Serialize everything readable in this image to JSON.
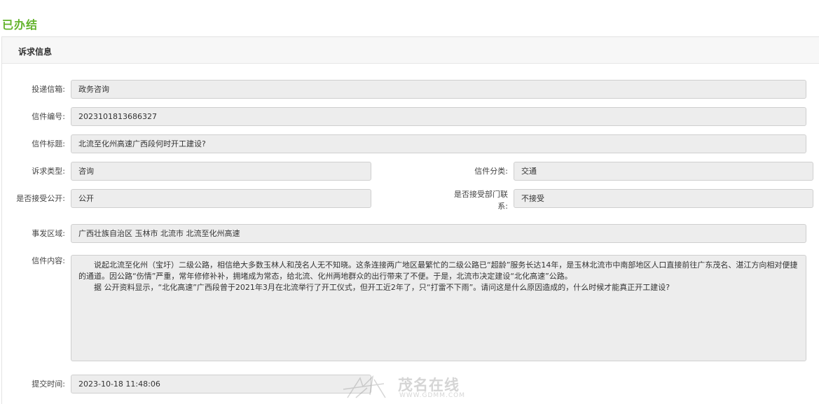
{
  "status": "已办结",
  "panel_title": "诉求信息",
  "fields": {
    "channel": {
      "label": "投递信箱:",
      "value": "政务咨询"
    },
    "letter_no": {
      "label": "信件编号:",
      "value": "2023101813686327"
    },
    "letter_title": {
      "label": "信件标题:",
      "value": "北流至化州高速广西段何时开工建设?"
    },
    "appeal_type": {
      "label": "诉求类型:",
      "value": "咨询"
    },
    "letter_category": {
      "label": "信件分类:",
      "value": "交通"
    },
    "public": {
      "label": "是否接受公开:",
      "value": "公开"
    },
    "dept_contact": {
      "label_line1": "是否接受部门联",
      "label_line2": "系:",
      "value": "不接受"
    },
    "region": {
      "label": "事发区域:",
      "value": "广西壮族自治区 玉林市 北流市 北流至化州高速"
    },
    "content": {
      "label": "信件内容:",
      "paragraphs": [
        "说起北流至化州（宝圩）二级公路，相信绝大多数玉林人和茂名人无不知晓。这条连接两广地区最繁忙的二级公路已“超龄”服务长达14年，是玉林北流市中南部地区人口直接前往广东茂名、湛江方向相对便捷的通道。因公路“伤情”严重，常年修修补补，拥堵成为常态，给北流、化州两地群众的出行带来了不便。于是，北流市决定建设“北化高速”公路。",
        "据 公开资料显示，“北化高速”广西段曾于2021年3月在北流举行了开工仪式，但开工近2年了，只“打雷不下雨”。请问这是什么原因造成的，什么时候才能真正开工建设?"
      ]
    },
    "submit_time": {
      "label": "提交时间:",
      "value": "2023-10-18 11:48:06"
    }
  },
  "watermark": {
    "brand": "茂名在线",
    "url": "WWW.GDMM.COM"
  }
}
